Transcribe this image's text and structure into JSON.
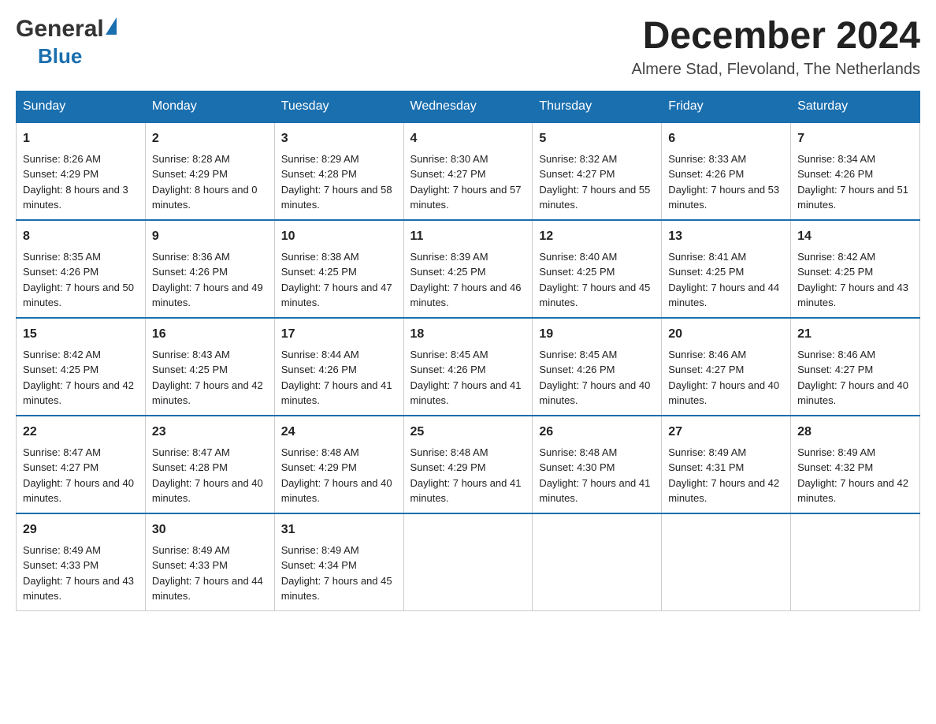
{
  "header": {
    "logo_general": "General",
    "logo_triangle": "▲",
    "logo_blue": "Blue",
    "month_title": "December 2024",
    "subtitle": "Almere Stad, Flevoland, The Netherlands"
  },
  "days_of_week": [
    "Sunday",
    "Monday",
    "Tuesday",
    "Wednesday",
    "Thursday",
    "Friday",
    "Saturday"
  ],
  "weeks": [
    [
      {
        "day": "1",
        "sunrise": "Sunrise: 8:26 AM",
        "sunset": "Sunset: 4:29 PM",
        "daylight": "Daylight: 8 hours and 3 minutes."
      },
      {
        "day": "2",
        "sunrise": "Sunrise: 8:28 AM",
        "sunset": "Sunset: 4:29 PM",
        "daylight": "Daylight: 8 hours and 0 minutes."
      },
      {
        "day": "3",
        "sunrise": "Sunrise: 8:29 AM",
        "sunset": "Sunset: 4:28 PM",
        "daylight": "Daylight: 7 hours and 58 minutes."
      },
      {
        "day": "4",
        "sunrise": "Sunrise: 8:30 AM",
        "sunset": "Sunset: 4:27 PM",
        "daylight": "Daylight: 7 hours and 57 minutes."
      },
      {
        "day": "5",
        "sunrise": "Sunrise: 8:32 AM",
        "sunset": "Sunset: 4:27 PM",
        "daylight": "Daylight: 7 hours and 55 minutes."
      },
      {
        "day": "6",
        "sunrise": "Sunrise: 8:33 AM",
        "sunset": "Sunset: 4:26 PM",
        "daylight": "Daylight: 7 hours and 53 minutes."
      },
      {
        "day": "7",
        "sunrise": "Sunrise: 8:34 AM",
        "sunset": "Sunset: 4:26 PM",
        "daylight": "Daylight: 7 hours and 51 minutes."
      }
    ],
    [
      {
        "day": "8",
        "sunrise": "Sunrise: 8:35 AM",
        "sunset": "Sunset: 4:26 PM",
        "daylight": "Daylight: 7 hours and 50 minutes."
      },
      {
        "day": "9",
        "sunrise": "Sunrise: 8:36 AM",
        "sunset": "Sunset: 4:26 PM",
        "daylight": "Daylight: 7 hours and 49 minutes."
      },
      {
        "day": "10",
        "sunrise": "Sunrise: 8:38 AM",
        "sunset": "Sunset: 4:25 PM",
        "daylight": "Daylight: 7 hours and 47 minutes."
      },
      {
        "day": "11",
        "sunrise": "Sunrise: 8:39 AM",
        "sunset": "Sunset: 4:25 PM",
        "daylight": "Daylight: 7 hours and 46 minutes."
      },
      {
        "day": "12",
        "sunrise": "Sunrise: 8:40 AM",
        "sunset": "Sunset: 4:25 PM",
        "daylight": "Daylight: 7 hours and 45 minutes."
      },
      {
        "day": "13",
        "sunrise": "Sunrise: 8:41 AM",
        "sunset": "Sunset: 4:25 PM",
        "daylight": "Daylight: 7 hours and 44 minutes."
      },
      {
        "day": "14",
        "sunrise": "Sunrise: 8:42 AM",
        "sunset": "Sunset: 4:25 PM",
        "daylight": "Daylight: 7 hours and 43 minutes."
      }
    ],
    [
      {
        "day": "15",
        "sunrise": "Sunrise: 8:42 AM",
        "sunset": "Sunset: 4:25 PM",
        "daylight": "Daylight: 7 hours and 42 minutes."
      },
      {
        "day": "16",
        "sunrise": "Sunrise: 8:43 AM",
        "sunset": "Sunset: 4:25 PM",
        "daylight": "Daylight: 7 hours and 42 minutes."
      },
      {
        "day": "17",
        "sunrise": "Sunrise: 8:44 AM",
        "sunset": "Sunset: 4:26 PM",
        "daylight": "Daylight: 7 hours and 41 minutes."
      },
      {
        "day": "18",
        "sunrise": "Sunrise: 8:45 AM",
        "sunset": "Sunset: 4:26 PM",
        "daylight": "Daylight: 7 hours and 41 minutes."
      },
      {
        "day": "19",
        "sunrise": "Sunrise: 8:45 AM",
        "sunset": "Sunset: 4:26 PM",
        "daylight": "Daylight: 7 hours and 40 minutes."
      },
      {
        "day": "20",
        "sunrise": "Sunrise: 8:46 AM",
        "sunset": "Sunset: 4:27 PM",
        "daylight": "Daylight: 7 hours and 40 minutes."
      },
      {
        "day": "21",
        "sunrise": "Sunrise: 8:46 AM",
        "sunset": "Sunset: 4:27 PM",
        "daylight": "Daylight: 7 hours and 40 minutes."
      }
    ],
    [
      {
        "day": "22",
        "sunrise": "Sunrise: 8:47 AM",
        "sunset": "Sunset: 4:27 PM",
        "daylight": "Daylight: 7 hours and 40 minutes."
      },
      {
        "day": "23",
        "sunrise": "Sunrise: 8:47 AM",
        "sunset": "Sunset: 4:28 PM",
        "daylight": "Daylight: 7 hours and 40 minutes."
      },
      {
        "day": "24",
        "sunrise": "Sunrise: 8:48 AM",
        "sunset": "Sunset: 4:29 PM",
        "daylight": "Daylight: 7 hours and 40 minutes."
      },
      {
        "day": "25",
        "sunrise": "Sunrise: 8:48 AM",
        "sunset": "Sunset: 4:29 PM",
        "daylight": "Daylight: 7 hours and 41 minutes."
      },
      {
        "day": "26",
        "sunrise": "Sunrise: 8:48 AM",
        "sunset": "Sunset: 4:30 PM",
        "daylight": "Daylight: 7 hours and 41 minutes."
      },
      {
        "day": "27",
        "sunrise": "Sunrise: 8:49 AM",
        "sunset": "Sunset: 4:31 PM",
        "daylight": "Daylight: 7 hours and 42 minutes."
      },
      {
        "day": "28",
        "sunrise": "Sunrise: 8:49 AM",
        "sunset": "Sunset: 4:32 PM",
        "daylight": "Daylight: 7 hours and 42 minutes."
      }
    ],
    [
      {
        "day": "29",
        "sunrise": "Sunrise: 8:49 AM",
        "sunset": "Sunset: 4:33 PM",
        "daylight": "Daylight: 7 hours and 43 minutes."
      },
      {
        "day": "30",
        "sunrise": "Sunrise: 8:49 AM",
        "sunset": "Sunset: 4:33 PM",
        "daylight": "Daylight: 7 hours and 44 minutes."
      },
      {
        "day": "31",
        "sunrise": "Sunrise: 8:49 AM",
        "sunset": "Sunset: 4:34 PM",
        "daylight": "Daylight: 7 hours and 45 minutes."
      },
      null,
      null,
      null,
      null
    ]
  ]
}
